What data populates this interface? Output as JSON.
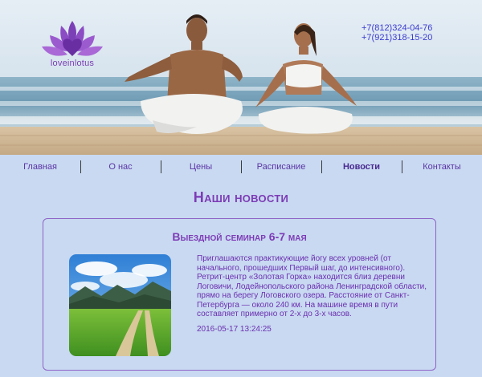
{
  "site": {
    "logo_text": "loveinlotus",
    "phones": [
      "+7(812)324-04-76",
      "+7(921)318-15-20"
    ]
  },
  "nav": {
    "items": [
      {
        "label": "Главная"
      },
      {
        "label": "О нас"
      },
      {
        "label": "Цены"
      },
      {
        "label": "Расписание"
      },
      {
        "label": "Новости",
        "active": true
      },
      {
        "label": "Контакты"
      }
    ]
  },
  "page": {
    "title": "Наши новости"
  },
  "news": [
    {
      "title": "Выездной семинар 6-7 мая",
      "text": "Приглашаются практикующие йогу всех уровней (от начального, прошедших Первый шаг, до интенсивного). Ретрит-центр «Золотая Горка» находится близ деревни Логовичи, Лодейнопольского района Ленинградской области, прямо на берегу Логовского озера. Расстояние от Санкт-Петербурга — около 240 км. На машине время в пути составляет примерно от 2-х до 3-х часов.",
      "date": "2016-05-17 13:24:25"
    }
  ],
  "colors": {
    "background": "#c8d9f1",
    "accent": "#7d3bb6",
    "phone_text": "#3a3ad0",
    "border": "#8f63c7"
  },
  "icons": {
    "logo": "lotus-icon"
  }
}
